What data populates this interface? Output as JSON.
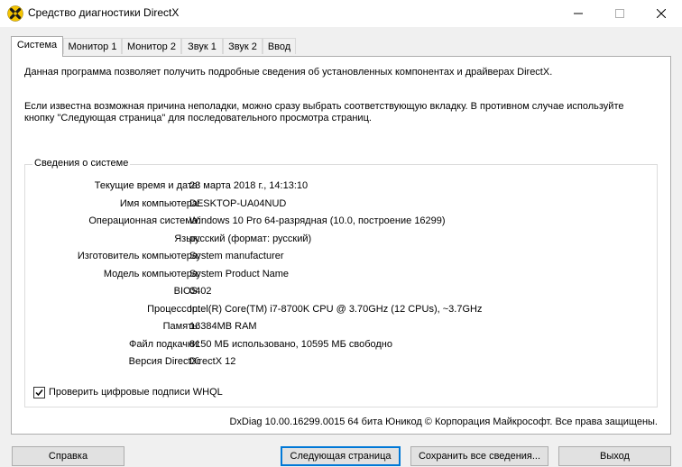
{
  "window": {
    "title": "Средство диагностики DirectX",
    "icon": "directx-icon",
    "controls": [
      "minimize-icon",
      "maximize-icon",
      "close-icon"
    ]
  },
  "tabs": [
    {
      "label": "Система",
      "active": true
    },
    {
      "label": "Монитор 1",
      "active": false
    },
    {
      "label": "Монитор 2",
      "active": false
    },
    {
      "label": "Звук 1",
      "active": false
    },
    {
      "label": "Звук 2",
      "active": false
    },
    {
      "label": "Ввод",
      "active": false
    }
  ],
  "intro": {
    "line1": "Данная программа позволяет получить подробные сведения об установленных компонентах и драйверах DirectX.",
    "line2": "Если известна возможная причина неполадки, можно сразу выбрать соответствующую вкладку. В противном случае используйте кнопку \"Следующая страница\" для последовательного просмотра страниц."
  },
  "system_info": {
    "legend": "Сведения о системе",
    "rows": [
      {
        "label": "Текущие время и дата:",
        "value": "23 марта 2018 г., 14:13:10"
      },
      {
        "label": "Имя компьютера:",
        "value": "DESKTOP-UA04NUD"
      },
      {
        "label": "Операционная система:",
        "value": "Windows 10 Pro 64-разрядная (10.0, построение 16299)"
      },
      {
        "label": "Язык:",
        "value": "русский (формат: русский)"
      },
      {
        "label": "Изготовитель компьютера:",
        "value": "System manufacturer"
      },
      {
        "label": "Модель компьютера:",
        "value": "System Product Name"
      },
      {
        "label": "BIOS:",
        "value": "0402"
      },
      {
        "label": "Процессор:",
        "value": "Intel(R) Core(TM) i7-8700K CPU @ 3.70GHz (12 CPUs), ~3.7GHz"
      },
      {
        "label": "Память:",
        "value": "16384MB RAM"
      },
      {
        "label": "Файл подкачки:",
        "value": "8150 МБ использовано, 10595 МБ свободно"
      },
      {
        "label": "Версия DirectX:",
        "value": "DirectX 12"
      }
    ]
  },
  "whql_checkbox": {
    "label": "Проверить цифровые подписи WHQL",
    "checked": true
  },
  "footer": "DxDiag 10.00.16299.0015 64 бита Юникод © Корпорация Майкрософт. Все права защищены.",
  "buttons": {
    "help": "Справка",
    "next": "Следующая страница",
    "save": "Сохранить все сведения...",
    "exit": "Выход"
  },
  "colors": {
    "accent": "#0078d7",
    "icon_yellow": "#f5c400",
    "icon_dark": "#1a1a1a"
  }
}
